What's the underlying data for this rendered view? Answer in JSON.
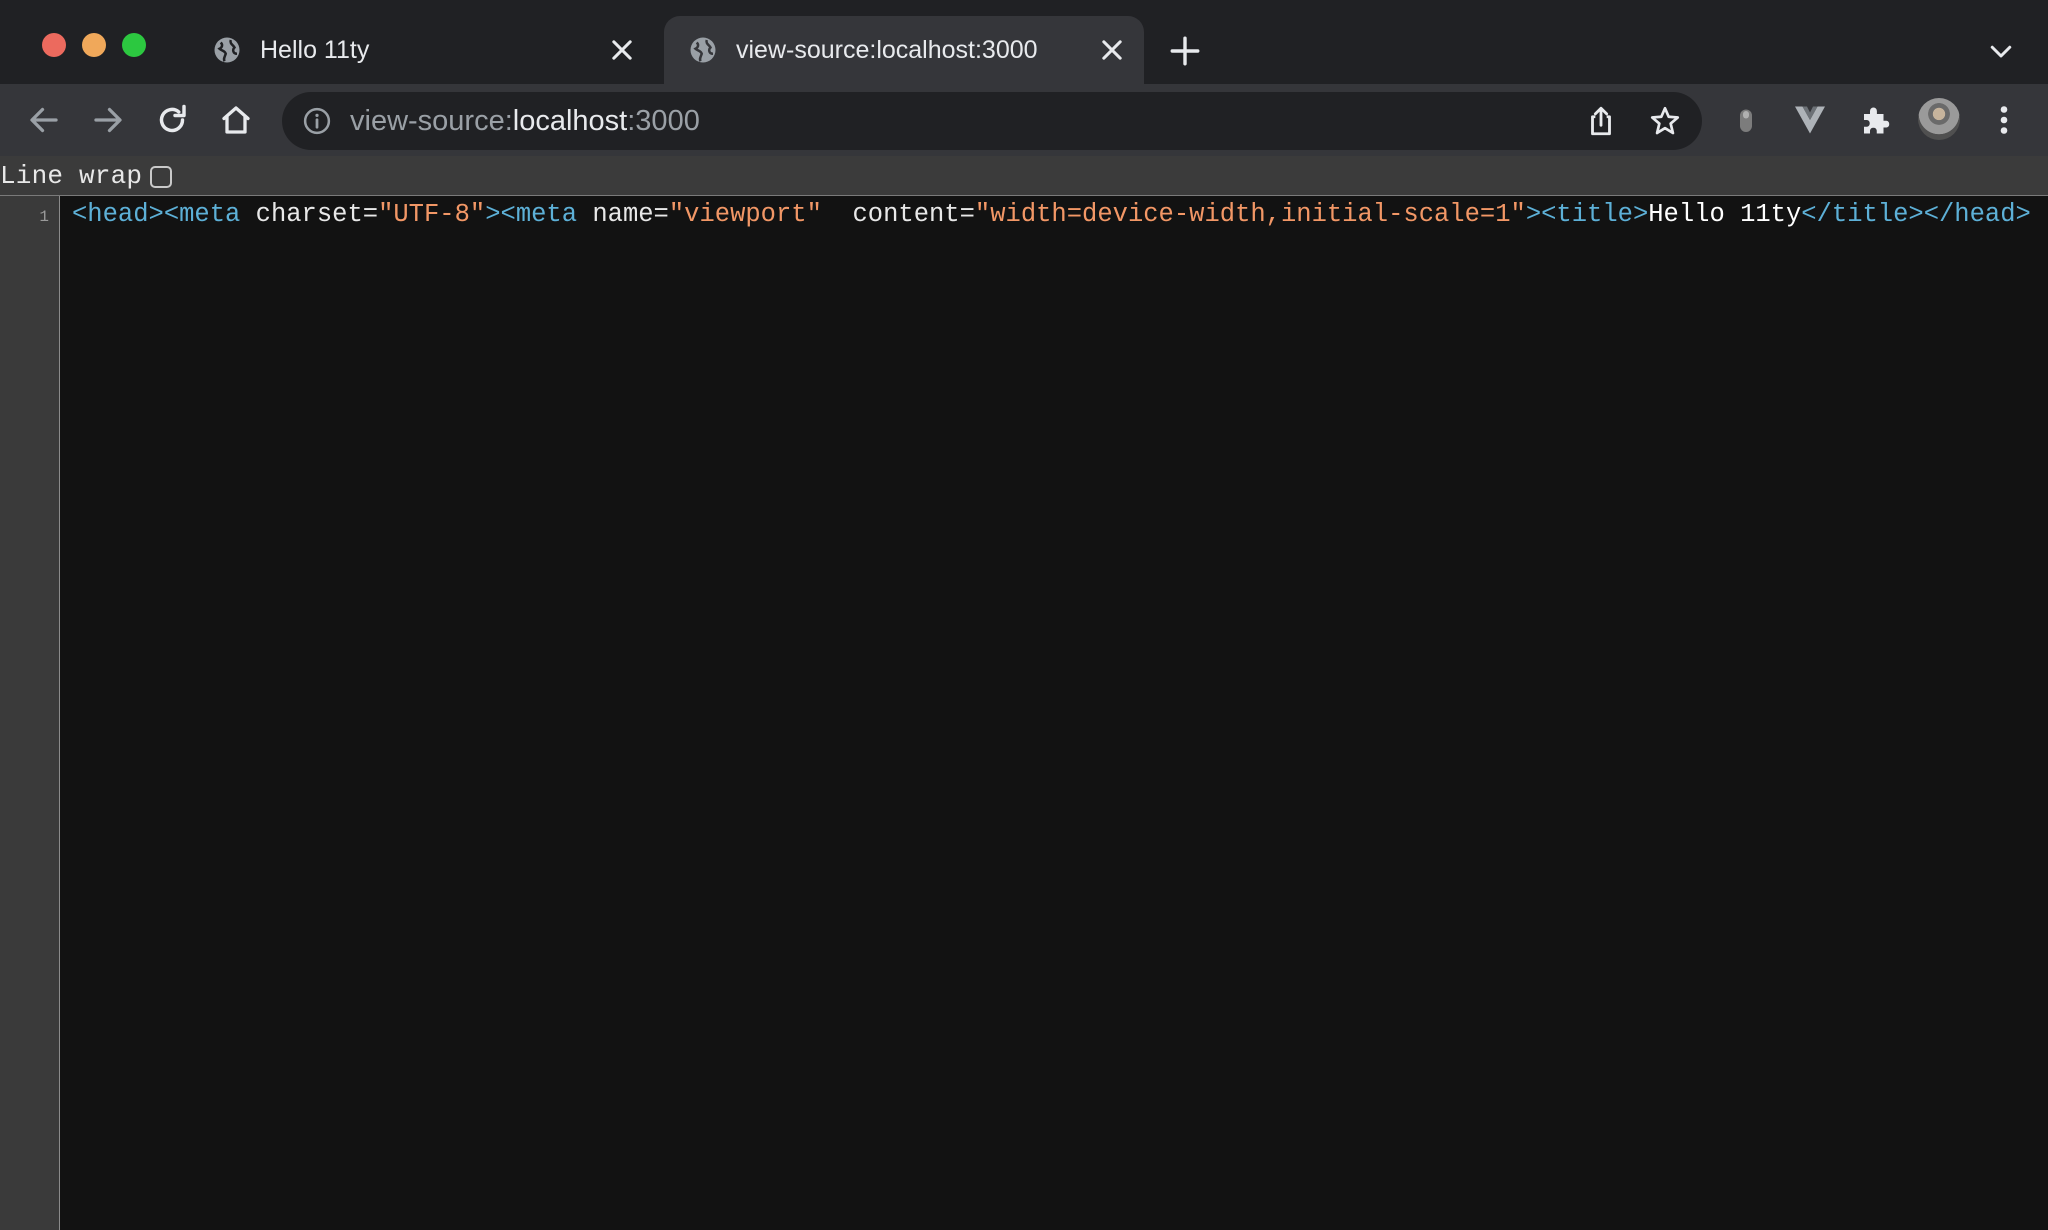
{
  "tabs": [
    {
      "title": "Hello 11ty",
      "active": false
    },
    {
      "title": "view-source:localhost:3000",
      "active": true
    }
  ],
  "address_bar": {
    "scheme_prefix": "view-source:",
    "host": "localhost",
    "port_suffix": ":3000"
  },
  "view_source": {
    "line_wrap_label": "Line wrap",
    "line_wrap_checked": false,
    "line_number": "1",
    "tokens": [
      "<head>",
      "<meta",
      " charset=",
      "\"UTF-8\"",
      ">",
      "<meta",
      " name=",
      "\"viewport\"",
      "  content=",
      "\"width=device-width,initial-scale=1\"",
      ">",
      "<title>",
      "Hello 11ty",
      "</title>",
      "</head>"
    ]
  },
  "colors": {
    "tab_strip": "#202124",
    "toolbar": "#35363a",
    "omnibox": "#202124",
    "page_background": "#121212",
    "gutter": "#3a3a3a",
    "syntax_tag": "#5db0d7",
    "syntax_attribute_value": "#f29766",
    "syntax_text": "#ffffff",
    "close_light": "#ec6a5e",
    "minimize_light": "#f0a85a",
    "maximize_light": "#2cc840"
  },
  "icons": {
    "back": "arrow-left",
    "forward": "arrow-right",
    "reload": "reload",
    "home": "home",
    "site_info": "info-circle",
    "share": "share",
    "bookmark": "star",
    "extensions": [
      "mic-pill",
      "vue-v",
      "puzzle-piece"
    ],
    "menu": "vertical-dots"
  }
}
